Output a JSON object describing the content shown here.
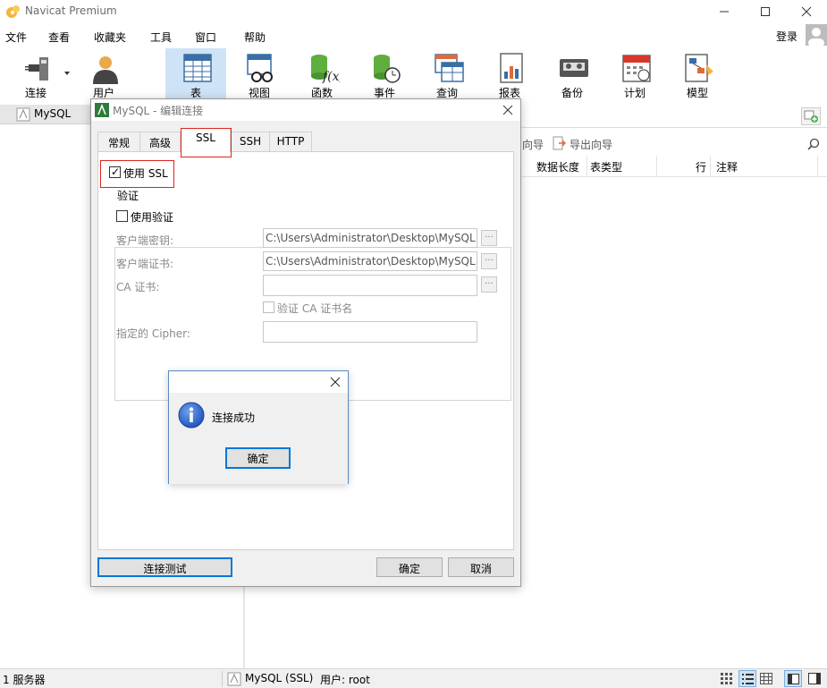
{
  "app": {
    "title": "Navicat Premium"
  },
  "menu": {
    "items": [
      "文件",
      "查看",
      "收藏夹",
      "工具",
      "窗口",
      "帮助"
    ],
    "login": "登录"
  },
  "toolbar": {
    "items": [
      {
        "label": "连接",
        "icon": "plug-icon"
      },
      {
        "label": "用户",
        "icon": "user-icon"
      },
      {
        "label": "表",
        "icon": "table-icon",
        "active": true
      },
      {
        "label": "视图",
        "icon": "view-icon"
      },
      {
        "label": "函数",
        "icon": "function-icon"
      },
      {
        "label": "事件",
        "icon": "event-icon"
      },
      {
        "label": "查询",
        "icon": "query-icon"
      },
      {
        "label": "报表",
        "icon": "report-icon"
      },
      {
        "label": "备份",
        "icon": "backup-icon"
      },
      {
        "label": "计划",
        "icon": "schedule-icon"
      },
      {
        "label": "模型",
        "icon": "model-icon"
      }
    ]
  },
  "nav": {
    "tab_label": "MySQL"
  },
  "content": {
    "toolbar": {
      "import_wizard": "向导",
      "export_wizard": "导出向导"
    },
    "columns": {
      "data_length": "数据长度",
      "table_type": "表类型",
      "rows": "行",
      "comment": "注释"
    }
  },
  "status": {
    "servers": "1 服务器",
    "connection": "MySQL (SSL)",
    "user": "用户: root"
  },
  "dialog": {
    "title": "MySQL - 编辑连接",
    "tabs": [
      "常规",
      "高级",
      "SSL",
      "SSH",
      "HTTP"
    ],
    "active_tab": "SSL",
    "use_ssl": {
      "label": "使用 SSL",
      "checked": true
    },
    "auth_group": "验证",
    "use_auth": {
      "label": "使用验证",
      "checked": false
    },
    "fields": {
      "client_key": {
        "label": "客户端密钥:",
        "value": "C:\\Users\\Administrator\\Desktop\\MySQL"
      },
      "client_cert": {
        "label": "客户端证书:",
        "value": "C:\\Users\\Administrator\\Desktop\\MySQL"
      },
      "ca_cert": {
        "label": "CA 证书:",
        "value": ""
      },
      "verify_ca": {
        "label": "验证 CA 证书名",
        "checked": false
      },
      "cipher": {
        "label": "指定的 Cipher:",
        "value": ""
      }
    },
    "browse_label": "...",
    "buttons": {
      "test": "连接测试",
      "ok": "确定",
      "cancel": "取消"
    }
  },
  "message_box": {
    "text": "连接成功",
    "ok": "确定",
    "icon": "info-icon"
  },
  "colors": {
    "accent": "#0078d7",
    "highlight": "#e0231e",
    "active_tool_bg": "#cfe3f7"
  }
}
